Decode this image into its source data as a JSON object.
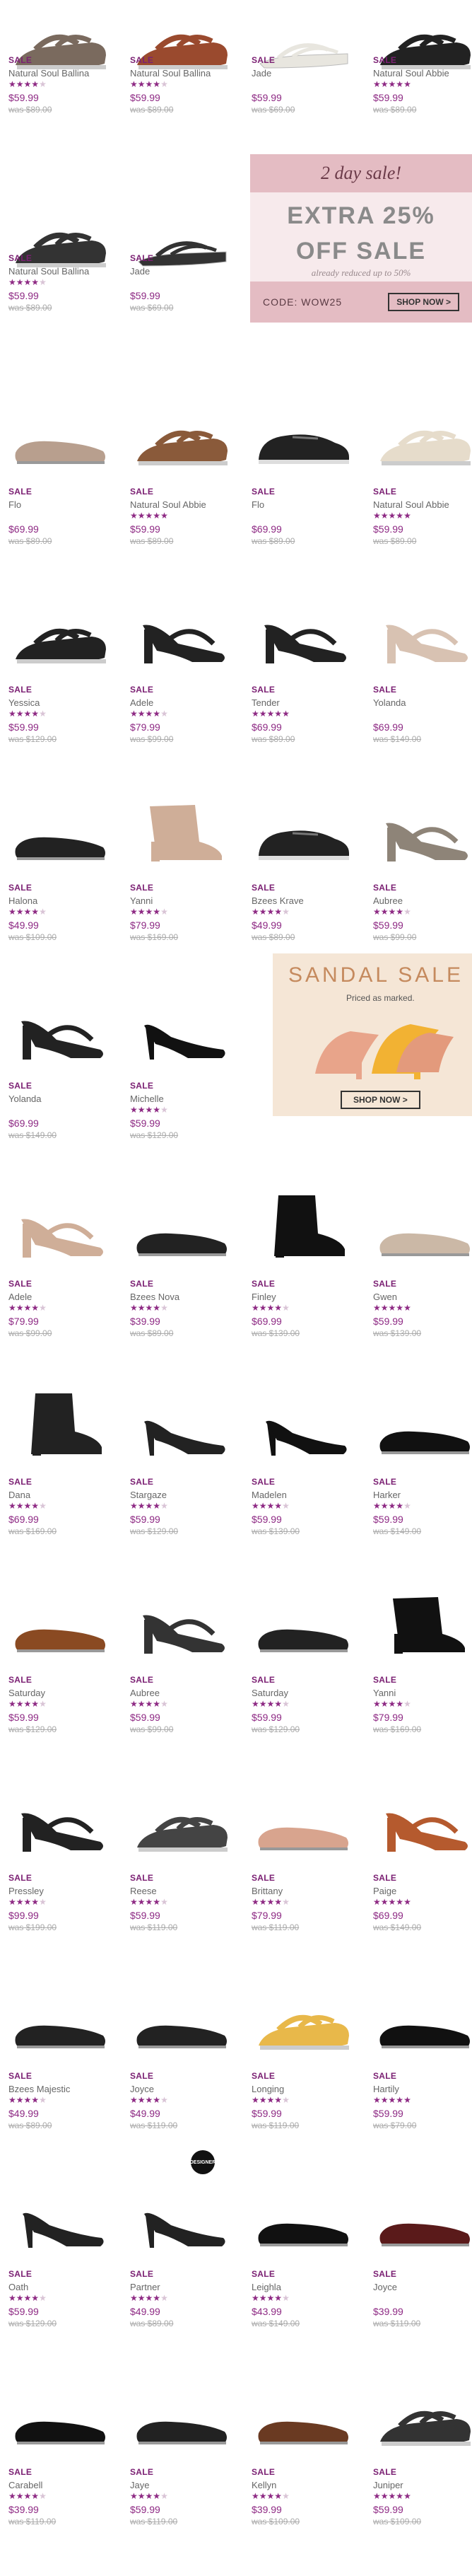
{
  "products": [
    {
      "name": "Natural Soul Ballina",
      "price": "$59.99",
      "was": "was $89.00",
      "stars": 4,
      "sale": "SALE"
    },
    {
      "name": "Natural Soul Ballina",
      "price": "$59.99",
      "was": "was $89.00",
      "stars": 4,
      "sale": "SALE"
    },
    {
      "name": "Jade",
      "price": "$59.99",
      "was": "was $69.00",
      "stars": 0,
      "sale": "SALE"
    },
    {
      "name": "Natural Soul Abbie",
      "price": "$59.99",
      "was": "was $89.00",
      "stars": 5,
      "sale": "SALE"
    },
    {
      "name": "Natural Soul Ballina",
      "price": "$59.99",
      "was": "was $89.00",
      "stars": 4,
      "sale": "SALE"
    },
    {
      "name": "Jade",
      "price": "$59.99",
      "was": "was $69.00",
      "stars": 0,
      "sale": "SALE"
    },
    {
      "name": "Flo",
      "price": "$69.99",
      "was": "was $89.00",
      "stars": 0,
      "sale": "SALE"
    },
    {
      "name": "Natural Soul Abbie",
      "price": "$59.99",
      "was": "was $89.00",
      "stars": 5,
      "sale": "SALE"
    },
    {
      "name": "Flo",
      "price": "$69.99",
      "was": "was $89.00",
      "stars": 0,
      "sale": "SALE"
    },
    {
      "name": "Natural Soul Abbie",
      "price": "$59.99",
      "was": "was $89.00",
      "stars": 5,
      "sale": "SALE"
    },
    {
      "name": "Yessica",
      "price": "$59.99",
      "was": "was $129.00",
      "stars": 4,
      "sale": "SALE"
    },
    {
      "name": "Adele",
      "price": "$79.99",
      "was": "was $99.00",
      "stars": 4,
      "sale": "SALE"
    },
    {
      "name": "Tender",
      "price": "$69.99",
      "was": "was $89.00",
      "stars": 5,
      "sale": "SALE"
    },
    {
      "name": "Yolanda",
      "price": "$69.99",
      "was": "was $149.00",
      "stars": 0,
      "sale": "SALE"
    },
    {
      "name": "Halona",
      "price": "$49.99",
      "was": "was $109.00",
      "stars": 4,
      "sale": "SALE"
    },
    {
      "name": "Yanni",
      "price": "$79.99",
      "was": "was $169.00",
      "stars": 4,
      "sale": "SALE"
    },
    {
      "name": "Bzees Krave",
      "price": "$49.99",
      "was": "was $89.00",
      "stars": 4,
      "sale": "SALE"
    },
    {
      "name": "Aubree",
      "price": "$59.99",
      "was": "was $99.00",
      "stars": 4,
      "sale": "SALE"
    },
    {
      "name": "Yolanda",
      "price": "$69.99",
      "was": "was $149.00",
      "stars": 0,
      "sale": "SALE"
    },
    {
      "name": "Michelle",
      "price": "$59.99",
      "was": "was $129.00",
      "stars": 4,
      "sale": "SALE"
    },
    {
      "name": "Adele",
      "price": "$79.99",
      "was": "was $99.00",
      "stars": 4,
      "sale": "SALE"
    },
    {
      "name": "Bzees Nova",
      "price": "$39.99",
      "was": "was $89.00",
      "stars": 4,
      "sale": "SALE"
    },
    {
      "name": "Finley",
      "price": "$69.99",
      "was": "was $139.00",
      "stars": 4,
      "sale": "SALE"
    },
    {
      "name": "Gwen",
      "price": "$59.99",
      "was": "was $139.00",
      "stars": 5,
      "sale": "SALE"
    },
    {
      "name": "Dana",
      "price": "$69.99",
      "was": "was $169.00",
      "stars": 4,
      "sale": "SALE"
    },
    {
      "name": "Stargaze",
      "price": "$59.99",
      "was": "was $129.00",
      "stars": 4,
      "sale": "SALE"
    },
    {
      "name": "Madelen",
      "price": "$59.99",
      "was": "was $139.00",
      "stars": 4,
      "sale": "SALE"
    },
    {
      "name": "Harker",
      "price": "$59.99",
      "was": "was $149.00",
      "stars": 4,
      "sale": "SALE"
    },
    {
      "name": "Saturday",
      "price": "$59.99",
      "was": "was $129.00",
      "stars": 4,
      "sale": "SALE"
    },
    {
      "name": "Aubree",
      "price": "$59.99",
      "was": "was $99.00",
      "stars": 4,
      "sale": "SALE"
    },
    {
      "name": "Saturday",
      "price": "$59.99",
      "was": "was $129.00",
      "stars": 4,
      "sale": "SALE"
    },
    {
      "name": "Yanni",
      "price": "$79.99",
      "was": "was $169.00",
      "stars": 4,
      "sale": "SALE"
    },
    {
      "name": "Pressley",
      "price": "$99.99",
      "was": "was $199.00",
      "stars": 4,
      "sale": "SALE"
    },
    {
      "name": "Reese",
      "price": "$59.99",
      "was": "was $119.00",
      "stars": 4,
      "sale": "SALE"
    },
    {
      "name": "Brittany",
      "price": "$79.99",
      "was": "was $119.00",
      "stars": 4,
      "sale": "SALE"
    },
    {
      "name": "Paige",
      "price": "$69.99",
      "was": "was $149.00",
      "stars": 5,
      "sale": "SALE"
    },
    {
      "name": "Bzees Majestic",
      "price": "$49.99",
      "was": "was $89.00",
      "stars": 4,
      "sale": "SALE"
    },
    {
      "name": "Joyce",
      "price": "$49.99",
      "was": "was $119.00",
      "stars": 4,
      "sale": "SALE"
    },
    {
      "name": "Longing",
      "price": "$59.99",
      "was": "was $119.00",
      "stars": 4,
      "sale": "SALE"
    },
    {
      "name": "Hartily",
      "price": "$59.99",
      "was": "was $79.00",
      "stars": 5,
      "sale": "SALE"
    },
    {
      "name": "Oath",
      "price": "$59.99",
      "was": "was $129.00",
      "stars": 4,
      "sale": "SALE"
    },
    {
      "name": "Partner",
      "price": "$49.99",
      "was": "was $89.00",
      "stars": 4,
      "sale": "SALE"
    },
    {
      "name": "Leighla",
      "price": "$43.99",
      "was": "was $149.00",
      "stars": 4,
      "sale": "SALE"
    },
    {
      "name": "Joyce",
      "price": "$39.99",
      "was": "was $119.00",
      "stars": 0,
      "sale": "SALE"
    },
    {
      "name": "Carabell",
      "price": "$39.99",
      "was": "was $119.00",
      "stars": 4,
      "sale": "SALE"
    },
    {
      "name": "Jaye",
      "price": "$59.99",
      "was": "was $119.00",
      "stars": 4,
      "sale": "SALE"
    },
    {
      "name": "Kellyn",
      "price": "$39.99",
      "was": "was $109.00",
      "stars": 4,
      "sale": "SALE"
    },
    {
      "name": "Juniper",
      "price": "$59.99",
      "was": "was $109.00",
      "stars": 5,
      "sale": "SALE"
    }
  ],
  "promo_twoday": {
    "top": "2 day sale!",
    "line1": "EXTRA 25%",
    "line2": "OFF SALE",
    "note": "already reduced up to 50%",
    "code": "CODE: WOW25",
    "button": "SHOP NOW >"
  },
  "promo_sandal": {
    "head": "SANDAL SALE",
    "sub": "Priced as marked.",
    "button": "SHOP NOW >"
  },
  "badge_text": "DESIGNER",
  "colors": {
    "accent": "#8e2a84",
    "sale": "#7b2073",
    "promo_pink": "#e4bcc3",
    "promo_cream": "#f5e6d6"
  }
}
